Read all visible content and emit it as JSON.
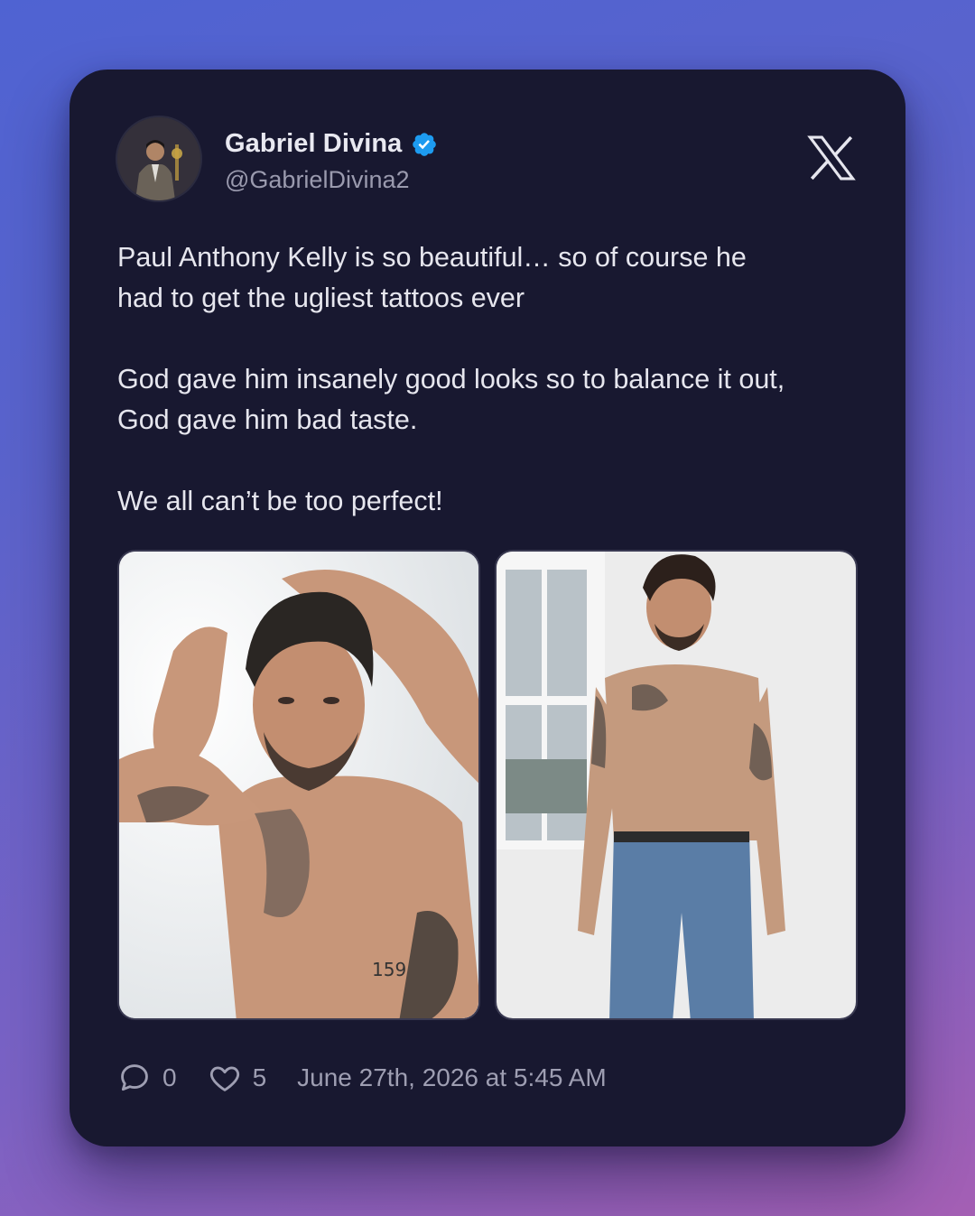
{
  "tweet": {
    "author_name": "Gabriel Divina",
    "author_handle": "@GabrielDivina2",
    "verified": true,
    "text": "Paul Anthony Kelly is so beautiful… so of course he\nhad to get the ugliest tattoos ever\n\nGod gave him insanely good looks so to balance it out,\nGod gave him bad taste.\n\nWe all can’t be too perfect!",
    "images": [
      {
        "icon": "photo-shirtless-man-adjusting-hair"
      },
      {
        "icon": "photo-shirtless-man-jeans-standing"
      }
    ],
    "replies_count": "0",
    "likes_count": "5",
    "timestamp": "June 27th, 2026 at 5:45 AM"
  },
  "colors": {
    "card_bg": "#181830",
    "verified_blue": "#1d9bf0",
    "text": "#e6e6ee",
    "muted": "#9e9eb2"
  },
  "icons": [
    "verified-badge-icon",
    "x-logo-icon",
    "reply-icon",
    "like-icon"
  ]
}
